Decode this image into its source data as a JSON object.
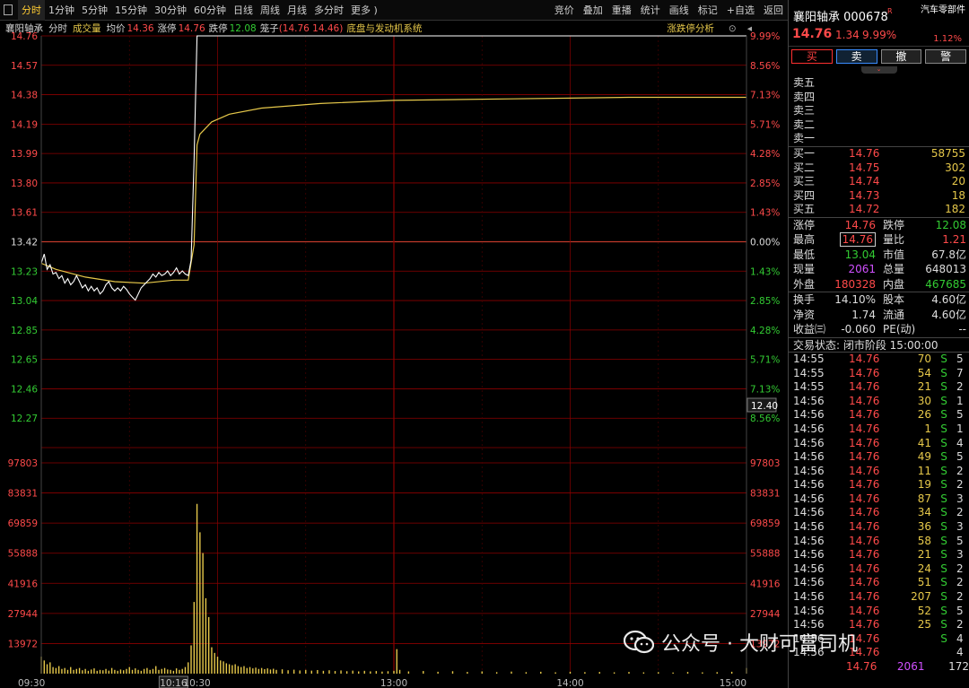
{
  "toolbar": {
    "tabs": [
      "分时",
      "1分钟",
      "5分钟",
      "15分钟",
      "30分钟",
      "60分钟",
      "日线",
      "周线",
      "月线",
      "多分时",
      "更多 )"
    ],
    "tools": [
      "竞价",
      "叠加",
      "重播",
      "统计",
      "画线",
      "标记",
      "+自选",
      "返回"
    ]
  },
  "infobar": {
    "name": "襄阳轴承",
    "mode": "分时",
    "vol_label": "成交量",
    "avg_label": "均价",
    "avg_value": "14.36",
    "limit_up_label": "涨停",
    "limit_up_value": "14.76",
    "limit_down_label": "跌停",
    "limit_down_value": "12.08",
    "cage_label": "笼子",
    "cage_value": "(14.76 14.46)",
    "concept": "底盘与发动机系统",
    "analysis": "涨跌停分析"
  },
  "chart_data": {
    "type": "line",
    "price_axis": {
      "labels": [
        "14.76",
        "14.57",
        "14.38",
        "14.19",
        "13.99",
        "13.80",
        "13.61",
        "13.42",
        "13.23",
        "13.04",
        "12.85",
        "12.65",
        "12.46",
        "12.27"
      ],
      "pct_labels": [
        "9.99%",
        "8.56%",
        "7.13%",
        "5.71%",
        "4.28%",
        "2.85%",
        "1.43%",
        "0.00%",
        "1.43%",
        "2.85%",
        "4.28%",
        "5.71%",
        "7.13%",
        "8.56%"
      ],
      "ylim": [
        12.08,
        14.76
      ],
      "prev_close": 13.42
    },
    "volume_axis": {
      "labels": [
        "97803",
        "83831",
        "69859",
        "55888",
        "41916",
        "27944",
        "13972"
      ],
      "ylim": [
        0,
        111775
      ]
    },
    "x_labels": [
      "09:30",
      "10:16",
      "10:30",
      "13:00",
      "14:00",
      "15:00"
    ],
    "cursor_time": "10:16",
    "cursor_price": "12.40",
    "price_series": [
      {
        "t": 0,
        "p": 13.28
      },
      {
        "t": 1,
        "p": 13.34
      },
      {
        "t": 2,
        "p": 13.24
      },
      {
        "t": 3,
        "p": 13.27
      },
      {
        "t": 4,
        "p": 13.21
      },
      {
        "t": 5,
        "p": 13.22
      },
      {
        "t": 6,
        "p": 13.18
      },
      {
        "t": 7,
        "p": 13.2
      },
      {
        "t": 8,
        "p": 13.15
      },
      {
        "t": 9,
        "p": 13.18
      },
      {
        "t": 10,
        "p": 13.14
      },
      {
        "t": 11,
        "p": 13.16
      },
      {
        "t": 12,
        "p": 13.2
      },
      {
        "t": 13,
        "p": 13.16
      },
      {
        "t": 14,
        "p": 13.12
      },
      {
        "t": 15,
        "p": 13.14
      },
      {
        "t": 16,
        "p": 13.1
      },
      {
        "t": 17,
        "p": 13.13
      },
      {
        "t": 18,
        "p": 13.1
      },
      {
        "t": 19,
        "p": 13.12
      },
      {
        "t": 20,
        "p": 13.08
      },
      {
        "t": 21,
        "p": 13.1
      },
      {
        "t": 22,
        "p": 13.14
      },
      {
        "t": 23,
        "p": 13.16
      },
      {
        "t": 24,
        "p": 13.12
      },
      {
        "t": 25,
        "p": 13.1
      },
      {
        "t": 26,
        "p": 13.12
      },
      {
        "t": 27,
        "p": 13.1
      },
      {
        "t": 28,
        "p": 13.13
      },
      {
        "t": 29,
        "p": 13.11
      },
      {
        "t": 30,
        "p": 13.08
      },
      {
        "t": 31,
        "p": 13.06
      },
      {
        "t": 32,
        "p": 13.04
      },
      {
        "t": 33,
        "p": 13.08
      },
      {
        "t": 34,
        "p": 13.12
      },
      {
        "t": 35,
        "p": 13.14
      },
      {
        "t": 36,
        "p": 13.16
      },
      {
        "t": 37,
        "p": 13.18
      },
      {
        "t": 38,
        "p": 13.21
      },
      {
        "t": 39,
        "p": 13.19
      },
      {
        "t": 40,
        "p": 13.22
      },
      {
        "t": 41,
        "p": 13.2
      },
      {
        "t": 42,
        "p": 13.21
      },
      {
        "t": 43,
        "p": 13.23
      },
      {
        "t": 44,
        "p": 13.2
      },
      {
        "t": 45,
        "p": 13.22
      },
      {
        "t": 46,
        "p": 13.25
      },
      {
        "t": 47,
        "p": 13.21
      },
      {
        "t": 48,
        "p": 13.23
      },
      {
        "t": 49,
        "p": 13.21
      },
      {
        "t": 50,
        "p": 13.2
      },
      {
        "t": 51,
        "p": 13.3
      },
      {
        "t": 52,
        "p": 13.95
      },
      {
        "t": 53,
        "p": 14.76
      },
      {
        "t": 240,
        "p": 14.76
      }
    ],
    "avg_series": [
      {
        "t": 0,
        "p": 13.28
      },
      {
        "t": 5,
        "p": 13.24
      },
      {
        "t": 15,
        "p": 13.19
      },
      {
        "t": 25,
        "p": 13.16
      },
      {
        "t": 35,
        "p": 13.15
      },
      {
        "t": 45,
        "p": 13.17
      },
      {
        "t": 50,
        "p": 13.17
      },
      {
        "t": 52,
        "p": 13.4
      },
      {
        "t": 53,
        "p": 14.05
      },
      {
        "t": 54,
        "p": 14.12
      },
      {
        "t": 58,
        "p": 14.2
      },
      {
        "t": 64,
        "p": 14.25
      },
      {
        "t": 75,
        "p": 14.29
      },
      {
        "t": 95,
        "p": 14.32
      },
      {
        "t": 120,
        "p": 14.34
      },
      {
        "t": 160,
        "p": 14.35
      },
      {
        "t": 200,
        "p": 14.36
      },
      {
        "t": 240,
        "p": 14.36
      }
    ],
    "volumes": [
      {
        "t": 0,
        "v": 9000
      },
      {
        "t": 1,
        "v": 7000
      },
      {
        "t": 2,
        "v": 5000
      },
      {
        "t": 3,
        "v": 6000
      },
      {
        "t": 4,
        "v": 3500
      },
      {
        "t": 5,
        "v": 3000
      },
      {
        "t": 6,
        "v": 4000
      },
      {
        "t": 7,
        "v": 2500
      },
      {
        "t": 8,
        "v": 3000
      },
      {
        "t": 9,
        "v": 2000
      },
      {
        "t": 10,
        "v": 3500
      },
      {
        "t": 11,
        "v": 2000
      },
      {
        "t": 12,
        "v": 2500
      },
      {
        "t": 13,
        "v": 3000
      },
      {
        "t": 14,
        "v": 1800
      },
      {
        "t": 15,
        "v": 2500
      },
      {
        "t": 16,
        "v": 1500
      },
      {
        "t": 17,
        "v": 2200
      },
      {
        "t": 18,
        "v": 2800
      },
      {
        "t": 19,
        "v": 1500
      },
      {
        "t": 20,
        "v": 2000
      },
      {
        "t": 21,
        "v": 1800
      },
      {
        "t": 22,
        "v": 2500
      },
      {
        "t": 23,
        "v": 1600
      },
      {
        "t": 24,
        "v": 3000
      },
      {
        "t": 25,
        "v": 2000
      },
      {
        "t": 26,
        "v": 1500
      },
      {
        "t": 27,
        "v": 2200
      },
      {
        "t": 28,
        "v": 1800
      },
      {
        "t": 29,
        "v": 2500
      },
      {
        "t": 30,
        "v": 3500
      },
      {
        "t": 31,
        "v": 2000
      },
      {
        "t": 32,
        "v": 2800
      },
      {
        "t": 33,
        "v": 2000
      },
      {
        "t": 34,
        "v": 1500
      },
      {
        "t": 35,
        "v": 2500
      },
      {
        "t": 36,
        "v": 3000
      },
      {
        "t": 37,
        "v": 2000
      },
      {
        "t": 38,
        "v": 2500
      },
      {
        "t": 39,
        "v": 4000
      },
      {
        "t": 40,
        "v": 2000
      },
      {
        "t": 41,
        "v": 2500
      },
      {
        "t": 42,
        "v": 3000
      },
      {
        "t": 43,
        "v": 2200
      },
      {
        "t": 44,
        "v": 2000
      },
      {
        "t": 45,
        "v": 1500
      },
      {
        "t": 46,
        "v": 2800
      },
      {
        "t": 47,
        "v": 2000
      },
      {
        "t": 48,
        "v": 2500
      },
      {
        "t": 49,
        "v": 3500
      },
      {
        "t": 50,
        "v": 6000
      },
      {
        "t": 51,
        "v": 15000
      },
      {
        "t": 52,
        "v": 38000
      },
      {
        "t": 53,
        "v": 90000
      },
      {
        "t": 54,
        "v": 75000
      },
      {
        "t": 55,
        "v": 64000
      },
      {
        "t": 56,
        "v": 40000
      },
      {
        "t": 57,
        "v": 30000
      },
      {
        "t": 58,
        "v": 14000
      },
      {
        "t": 59,
        "v": 11000
      },
      {
        "t": 60,
        "v": 9000
      },
      {
        "t": 61,
        "v": 7000
      },
      {
        "t": 62,
        "v": 6500
      },
      {
        "t": 63,
        "v": 5500
      },
      {
        "t": 64,
        "v": 5000
      },
      {
        "t": 65,
        "v": 4500
      },
      {
        "t": 66,
        "v": 5000
      },
      {
        "t": 67,
        "v": 4000
      },
      {
        "t": 68,
        "v": 3500
      },
      {
        "t": 69,
        "v": 4000
      },
      {
        "t": 70,
        "v": 3000
      },
      {
        "t": 71,
        "v": 3500
      },
      {
        "t": 72,
        "v": 2800
      },
      {
        "t": 73,
        "v": 3200
      },
      {
        "t": 74,
        "v": 2500
      },
      {
        "t": 75,
        "v": 3000
      },
      {
        "t": 76,
        "v": 2400
      },
      {
        "t": 77,
        "v": 2800
      },
      {
        "t": 78,
        "v": 2200
      },
      {
        "t": 79,
        "v": 2600
      },
      {
        "t": 80,
        "v": 2000
      },
      {
        "t": 82,
        "v": 2300
      },
      {
        "t": 84,
        "v": 1800
      },
      {
        "t": 86,
        "v": 2100
      },
      {
        "t": 88,
        "v": 1700
      },
      {
        "t": 90,
        "v": 2000
      },
      {
        "t": 92,
        "v": 1600
      },
      {
        "t": 94,
        "v": 1900
      },
      {
        "t": 96,
        "v": 1500
      },
      {
        "t": 98,
        "v": 1800
      },
      {
        "t": 100,
        "v": 1400
      },
      {
        "t": 102,
        "v": 1700
      },
      {
        "t": 104,
        "v": 1300
      },
      {
        "t": 106,
        "v": 1600
      },
      {
        "t": 108,
        "v": 1200
      },
      {
        "t": 110,
        "v": 1500
      },
      {
        "t": 112,
        "v": 1200
      },
      {
        "t": 114,
        "v": 1400
      },
      {
        "t": 116,
        "v": 1100
      },
      {
        "t": 118,
        "v": 1300
      },
      {
        "t": 120,
        "v": 1500
      },
      {
        "t": 121,
        "v": 13000
      },
      {
        "t": 122,
        "v": 2000
      },
      {
        "t": 125,
        "v": 1200
      },
      {
        "t": 130,
        "v": 1400
      },
      {
        "t": 135,
        "v": 1000
      },
      {
        "t": 140,
        "v": 1300
      },
      {
        "t": 145,
        "v": 900
      },
      {
        "t": 150,
        "v": 1200
      },
      {
        "t": 155,
        "v": 800
      },
      {
        "t": 160,
        "v": 1100
      },
      {
        "t": 165,
        "v": 800
      },
      {
        "t": 170,
        "v": 1000
      },
      {
        "t": 175,
        "v": 700
      },
      {
        "t": 180,
        "v": 1000
      },
      {
        "t": 185,
        "v": 800
      },
      {
        "t": 190,
        "v": 900
      },
      {
        "t": 195,
        "v": 700
      },
      {
        "t": 200,
        "v": 900
      },
      {
        "t": 205,
        "v": 700
      },
      {
        "t": 210,
        "v": 800
      },
      {
        "t": 215,
        "v": 600
      },
      {
        "t": 220,
        "v": 900
      },
      {
        "t": 225,
        "v": 700
      },
      {
        "t": 230,
        "v": 800
      },
      {
        "t": 235,
        "v": 1000
      },
      {
        "t": 240,
        "v": 3000
      }
    ],
    "colors": {
      "price": "#ffffff",
      "avg": "#e6c84a",
      "grid": "#8b0000",
      "volume": "#e6c84a",
      "label_red": "#ff4a4a",
      "label_green": "#33cc33"
    }
  },
  "panel": {
    "name": "襄阳轴承",
    "code": "000678",
    "badge": "R",
    "price": "14.76",
    "change": "1.34",
    "change_pct": "9.99%",
    "sector": "汽车零部件",
    "sector_pct": "1.12%",
    "buttons": {
      "buy": "买",
      "sell": "卖",
      "cancel": "撤",
      "alert": "警"
    },
    "asks": [
      {
        "label": "卖五",
        "price": "",
        "vol": ""
      },
      {
        "label": "卖四",
        "price": "",
        "vol": ""
      },
      {
        "label": "卖三",
        "price": "",
        "vol": ""
      },
      {
        "label": "卖二",
        "price": "",
        "vol": ""
      },
      {
        "label": "卖一",
        "price": "",
        "vol": ""
      }
    ],
    "bids": [
      {
        "label": "买一",
        "price": "14.76",
        "vol": "58755"
      },
      {
        "label": "买二",
        "price": "14.75",
        "vol": "302"
      },
      {
        "label": "买三",
        "price": "14.74",
        "vol": "20"
      },
      {
        "label": "买四",
        "price": "14.73",
        "vol": "18"
      },
      {
        "label": "买五",
        "price": "14.72",
        "vol": "182"
      }
    ],
    "stats1": [
      {
        "k": "涨停",
        "v": "14.76",
        "vc": "red",
        "k2": "跌停",
        "v2": "12.08",
        "v2c": "green"
      },
      {
        "k": "最高",
        "v": "14.76",
        "vc": "red",
        "boxed": true,
        "k2": "量比",
        "v2": "1.21",
        "v2c": "red"
      },
      {
        "k": "最低",
        "v": "13.04",
        "vc": "green",
        "k2": "市值",
        "v2": "67.8亿",
        "v2c": "white"
      },
      {
        "k": "现量",
        "v": "2061",
        "vc": "purple",
        "k2": "总量",
        "v2": "648013",
        "v2c": "white"
      },
      {
        "k": "外盘",
        "v": "180328",
        "vc": "red",
        "k2": "内盘",
        "v2": "467685",
        "v2c": "green"
      }
    ],
    "stats2": [
      {
        "k": "换手",
        "v": "14.10%",
        "vc": "white",
        "k2": "股本",
        "v2": "4.60亿",
        "v2c": "white"
      },
      {
        "k": "净资",
        "v": "1.74",
        "vc": "white",
        "k2": "流通",
        "v2": "4.60亿",
        "v2c": "white"
      },
      {
        "k": "收益㈢",
        "v": "-0.060",
        "vc": "white",
        "k2": "PE(动)",
        "v2": "--",
        "v2c": "white"
      }
    ],
    "status": "交易状态: 闭市阶段 15:00:00",
    "ticks": [
      {
        "t": "14:55",
        "p": "14.76",
        "v": "70",
        "bs": "S",
        "n": "5"
      },
      {
        "t": "14:55",
        "p": "14.76",
        "v": "54",
        "bs": "S",
        "n": "7"
      },
      {
        "t": "14:55",
        "p": "14.76",
        "v": "21",
        "bs": "S",
        "n": "2"
      },
      {
        "t": "14:56",
        "p": "14.76",
        "v": "30",
        "bs": "S",
        "n": "1"
      },
      {
        "t": "14:56",
        "p": "14.76",
        "v": "26",
        "bs": "S",
        "n": "5"
      },
      {
        "t": "14:56",
        "p": "14.76",
        "v": "1",
        "bs": "S",
        "n": "1"
      },
      {
        "t": "14:56",
        "p": "14.76",
        "v": "41",
        "bs": "S",
        "n": "4"
      },
      {
        "t": "14:56",
        "p": "14.76",
        "v": "49",
        "bs": "S",
        "n": "5"
      },
      {
        "t": "14:56",
        "p": "14.76",
        "v": "11",
        "bs": "S",
        "n": "2"
      },
      {
        "t": "14:56",
        "p": "14.76",
        "v": "19",
        "bs": "S",
        "n": "2"
      },
      {
        "t": "14:56",
        "p": "14.76",
        "v": "87",
        "bs": "S",
        "n": "3"
      },
      {
        "t": "14:56",
        "p": "14.76",
        "v": "34",
        "bs": "S",
        "n": "2"
      },
      {
        "t": "14:56",
        "p": "14.76",
        "v": "36",
        "bs": "S",
        "n": "3"
      },
      {
        "t": "14:56",
        "p": "14.76",
        "v": "58",
        "bs": "S",
        "n": "5"
      },
      {
        "t": "14:56",
        "p": "14.76",
        "v": "21",
        "bs": "S",
        "n": "3"
      },
      {
        "t": "14:56",
        "p": "14.76",
        "v": "24",
        "bs": "S",
        "n": "2"
      },
      {
        "t": "14:56",
        "p": "14.76",
        "v": "51",
        "bs": "S",
        "n": "2"
      },
      {
        "t": "14:56",
        "p": "14.76",
        "v": "207",
        "bs": "S",
        "n": "2"
      },
      {
        "t": "14:56",
        "p": "14.76",
        "v": "52",
        "bs": "S",
        "n": "5"
      },
      {
        "t": "14:56",
        "p": "14.76",
        "v": "25",
        "bs": "S",
        "n": "2"
      },
      {
        "t": "14:56",
        "p": "14.76",
        "v": "",
        "bs": "S",
        "n": "4"
      },
      {
        "t": "14:56",
        "p": "14.76",
        "v": "",
        "bs": "",
        "n": "4"
      },
      {
        "t": "",
        "p": "14.76",
        "v": "2061",
        "bs": "",
        "n": "172"
      }
    ]
  },
  "watermark": {
    "text": "公众号 · 大财可富司机"
  }
}
